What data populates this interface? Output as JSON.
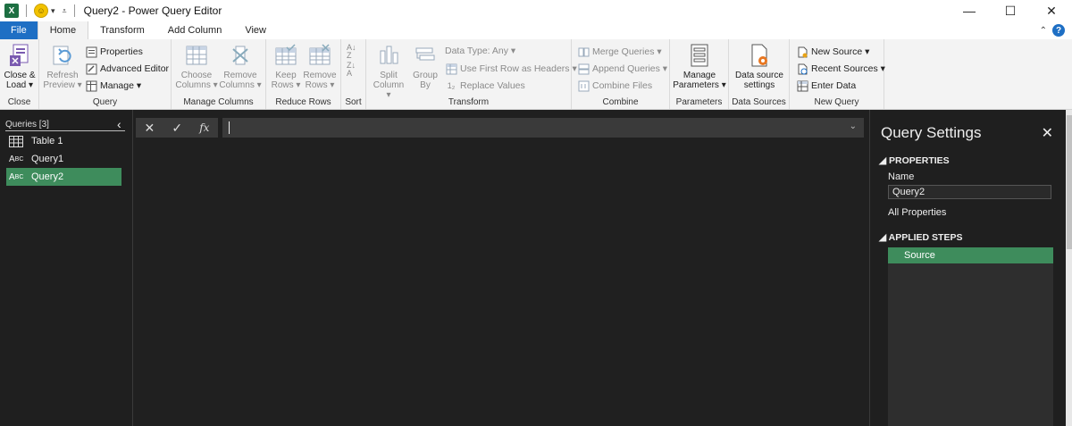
{
  "window": {
    "title": "Query2 - Power Query Editor",
    "app_icon": "X",
    "controls": {
      "minimize": "—",
      "maximize": "☐",
      "close": "✕"
    }
  },
  "tabs": [
    "File",
    "Home",
    "Transform",
    "Add Column",
    "View"
  ],
  "ribbon": {
    "close_group": {
      "close_load": "Close &\nLoad ▾",
      "label": "Close"
    },
    "query_group": {
      "refresh": "Refresh\nPreview ▾",
      "properties": "Properties",
      "advanced_editor": "Advanced Editor",
      "manage": "Manage ▾",
      "label": "Query"
    },
    "manage_columns_group": {
      "choose": "Choose\nColumns ▾",
      "remove": "Remove\nColumns ▾",
      "label": "Manage Columns"
    },
    "reduce_rows_group": {
      "keep": "Keep\nRows ▾",
      "remove": "Remove\nRows ▾",
      "label": "Reduce Rows"
    },
    "sort_group": {
      "label": "Sort"
    },
    "transform_group": {
      "split": "Split\nColumn ▾",
      "group_by": "Group\nBy",
      "data_type": "Data Type: Any ▾",
      "first_row": "Use First Row as Headers ▾",
      "replace": "Replace Values",
      "label": "Transform"
    },
    "combine_group": {
      "merge": "Merge Queries ▾",
      "append": "Append Queries ▾",
      "combine_files": "Combine Files",
      "label": "Combine"
    },
    "parameters_group": {
      "manage": "Manage\nParameters ▾",
      "label": "Parameters"
    },
    "data_sources_group": {
      "settings": "Data source\nsettings",
      "label": "Data Sources"
    },
    "new_query_group": {
      "new_source": "New Source ▾",
      "recent_sources": "Recent Sources ▾",
      "enter_data": "Enter Data",
      "label": "New Query"
    }
  },
  "queries": {
    "header": "Queries [3]",
    "items": [
      {
        "label": "Table 1",
        "icon": "table-icon",
        "selected": false
      },
      {
        "label": "Query1",
        "icon": "abc-icon",
        "selected": false
      },
      {
        "label": "Query2",
        "icon": "abc-icon",
        "selected": true
      }
    ]
  },
  "formula_bar": {
    "cancel": "✕",
    "commit": "✓",
    "fx": "fx",
    "value": ""
  },
  "query_settings": {
    "title": "Query Settings",
    "properties_header": "PROPERTIES",
    "name_label": "Name",
    "name_value": "Query2",
    "all_properties": "All Properties",
    "applied_steps_header": "APPLIED STEPS",
    "steps": [
      "Source"
    ]
  },
  "colors": {
    "accent_green": "#3e8c5c",
    "file_blue": "#1e6fc4"
  }
}
